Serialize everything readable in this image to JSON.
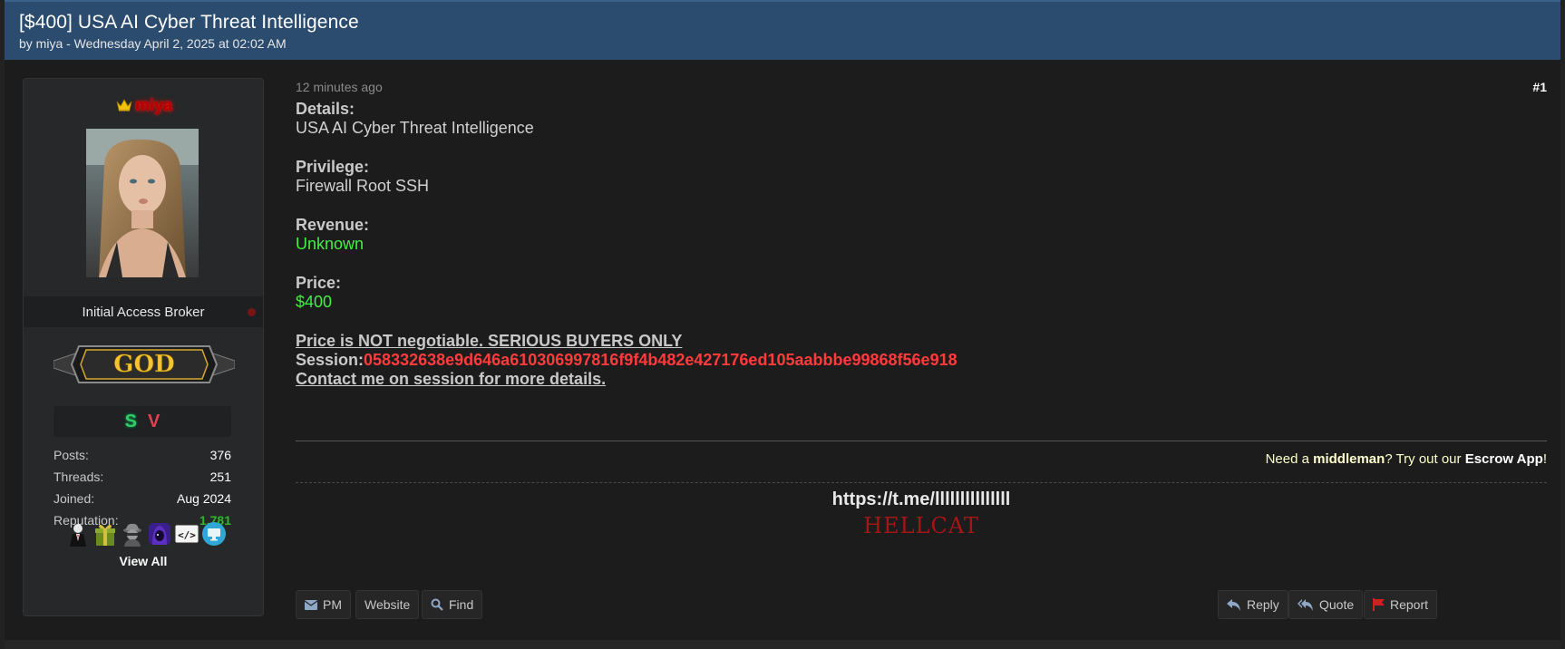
{
  "thread": {
    "title": "[$400] USA AI Cyber Threat Intelligence",
    "meta": "by miya - Wednesday April 2, 2025 at 02:02 AM"
  },
  "user": {
    "username": "miya",
    "usertitle": "Initial Access Broker",
    "rank": "GOD",
    "award_letters": [
      "S",
      "V"
    ],
    "stats": [
      {
        "label": "Posts:",
        "value": "376"
      },
      {
        "label": "Threads:",
        "value": "251"
      },
      {
        "label": "Joined:",
        "value": "Aug 2024"
      },
      {
        "label": "Reputation:",
        "value": "1,781"
      }
    ],
    "award_icons": [
      "suit-icon",
      "gift-icon",
      "spy-icon",
      "hood-icon",
      "code-icon",
      "monitor-icon"
    ],
    "view_all": "View All"
  },
  "post": {
    "time": "12 minutes ago",
    "number": "#1",
    "details_label": "Details:",
    "details_value": "USA AI Cyber Threat Intelligence",
    "privilege_label": "Privilege:",
    "privilege_value": "Firewall Root SSH",
    "revenue_label": "Revenue:",
    "revenue_value": "Unknown",
    "price_label": "Price:",
    "price_value": "$400",
    "notice": "Price is NOT negotiable. SERIOUS BUYERS ONLY",
    "session_label": "Session:",
    "session_id": "058332638e9d646a610306997816f9f4b482e427176ed105aabbbe99868f56e918",
    "contact": "Contact me on session for more details."
  },
  "escrow": {
    "prefix": "Need a ",
    "middleman": "middleman",
    "middle": "? Try out our ",
    "app": "Escrow App",
    "suffix": "!"
  },
  "signature": {
    "link": "https://t.me/lllllllllllllll",
    "name": "HELLCAT"
  },
  "buttons": {
    "pm": "PM",
    "website": "Website",
    "find": "Find",
    "reply": "Reply",
    "quote": "Quote",
    "report": "Report"
  },
  "colors": {
    "header_bg": "#2b4c6e",
    "username": "#b40000",
    "green_value": "#44ee44",
    "session": "#ff3b3b",
    "reputation": "#2fb52f"
  }
}
